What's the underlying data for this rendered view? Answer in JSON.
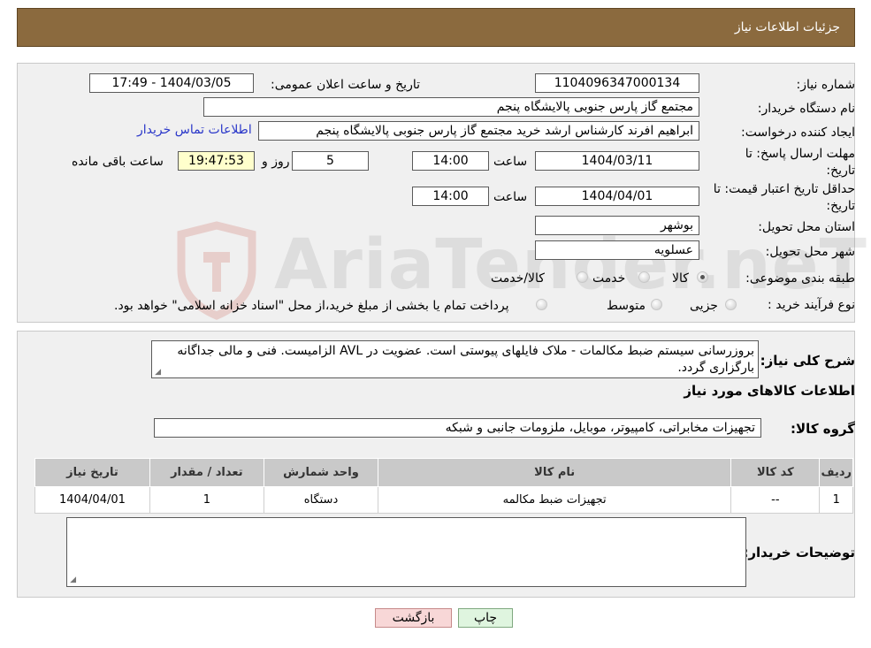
{
  "header": {
    "title": "جزئیات اطلاعات نیاز"
  },
  "watermark": {
    "text": "AriaTender.neT"
  },
  "form": {
    "need_number_label": "شماره نیاز:",
    "need_number": "1104096347000134",
    "announce_label": "تاریخ و ساعت اعلان عمومی:",
    "announce_value": "1404/03/05 - 17:49",
    "buyer_label": "نام دستگاه خریدار:",
    "buyer_value": "مجتمع گاز پارس جنوبی  پالایشگاه پنجم",
    "creator_label": "ایجاد کننده درخواست:",
    "creator_value": "ابراهیم افرند کارشناس ارشد خرید مجتمع گاز پارس جنوبی  پالایشگاه پنجم",
    "contact_link": "اطلاعات تماس خریدار",
    "deadline_label": "مهلت ارسال پاسخ: تا تاریخ:",
    "deadline_date": "1404/03/11",
    "time_label": "ساعت",
    "deadline_time": "14:00",
    "days_value": "5",
    "days_label": "روز و",
    "remaining_time": "19:47:53",
    "remaining_label": "ساعت باقی مانده",
    "min_valid_label": "حداقل تاریخ اعتبار قیمت: تا تاریخ:",
    "min_valid_date": "1404/04/01",
    "min_valid_time": "14:00",
    "province_label": "استان محل تحویل:",
    "province_value": "بوشهر",
    "city_label": "شهر محل تحویل:",
    "city_value": "عسلویه",
    "category_label": "طبقه بندی موضوعی:",
    "category_options": [
      "کالا",
      "خدمت",
      "کالا/خدمت"
    ],
    "category_selected": "کالا",
    "process_label": "نوع فرآیند خرید :",
    "process_options": [
      "جزیی",
      "متوسط"
    ],
    "process_note": "پرداخت تمام یا بخشی از مبلغ خرید،از محل \"اسناد خزانه اسلامی\" خواهد بود."
  },
  "details": {
    "description_label": "شرح کلی نیاز:",
    "description_value": "بروزرسانی سیستم ضبط مکالمات - ملاک فایلهای پیوستی است. عضویت در AVL الزامیست. فنی و مالی جداگانه بارگزاری گردد.",
    "items_title": "اطلاعات کالاهای مورد نیاز",
    "group_label": "گروه کالا:",
    "group_value": "تجهیزات مخابراتی، کامپیوتر، موبایل، ملزومات جانبی و شبکه",
    "table": {
      "headers": [
        "ردیف",
        "کد کالا",
        "نام کالا",
        "واحد شمارش",
        "تعداد / مقدار",
        "تاریخ نیاز"
      ],
      "rows": [
        [
          "1",
          "--",
          "تجهیزات ضبط مکالمه",
          "دستگاه",
          "1",
          "1404/04/01"
        ]
      ]
    },
    "buyer_notes_label": "توضیحات خریدار:",
    "buyer_notes_value": ""
  },
  "actions": {
    "print_label": "چاپ",
    "back_label": "بازگشت"
  },
  "colors": {
    "header_bg": "#8b6a3e",
    "link": "#2a37c9",
    "timer_bg": "#ffffcc"
  }
}
